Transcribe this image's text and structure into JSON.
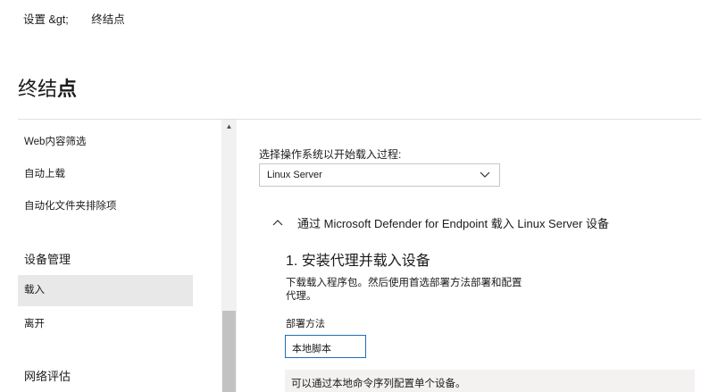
{
  "breadcrumb": {
    "parent": "设置",
    "separator": "&gt;",
    "current": "终结点"
  },
  "page_title": {
    "prefix": "终结",
    "bold": "点"
  },
  "sidebar": {
    "items": [
      {
        "label": "Web内容筛选"
      },
      {
        "label": "自动上载"
      },
      {
        "label": "自动化文件夹排除项"
      }
    ],
    "group_device": "设备管理",
    "device_items": [
      {
        "label": "载入",
        "selected": true
      },
      {
        "label": "离开",
        "selected": false
      }
    ],
    "group_network": "网络评估"
  },
  "main": {
    "os_label": "选择操作系统以开始载入过程:",
    "os_value": "Linux Server",
    "section_title": "通过 Microsoft Defender for Endpoint 载入 Linux Server 设备",
    "step_title": "1. 安装代理并载入设备",
    "step_desc": "下载载入程序包。然后使用首选部署方法部署和配置代理。",
    "deploy_label": "部署方法",
    "deploy_value": "本地脚本",
    "info_text": "可以通过本地命令序列配置单个设备。"
  },
  "colors": {
    "selected_bg": "#e8e8e8",
    "focus_border": "#1f6fb8",
    "info_bg": "#f3f2f1"
  },
  "icons": [
    "chevron-down-icon",
    "chevron-up-icon",
    "scroll-up-arrow-icon"
  ]
}
